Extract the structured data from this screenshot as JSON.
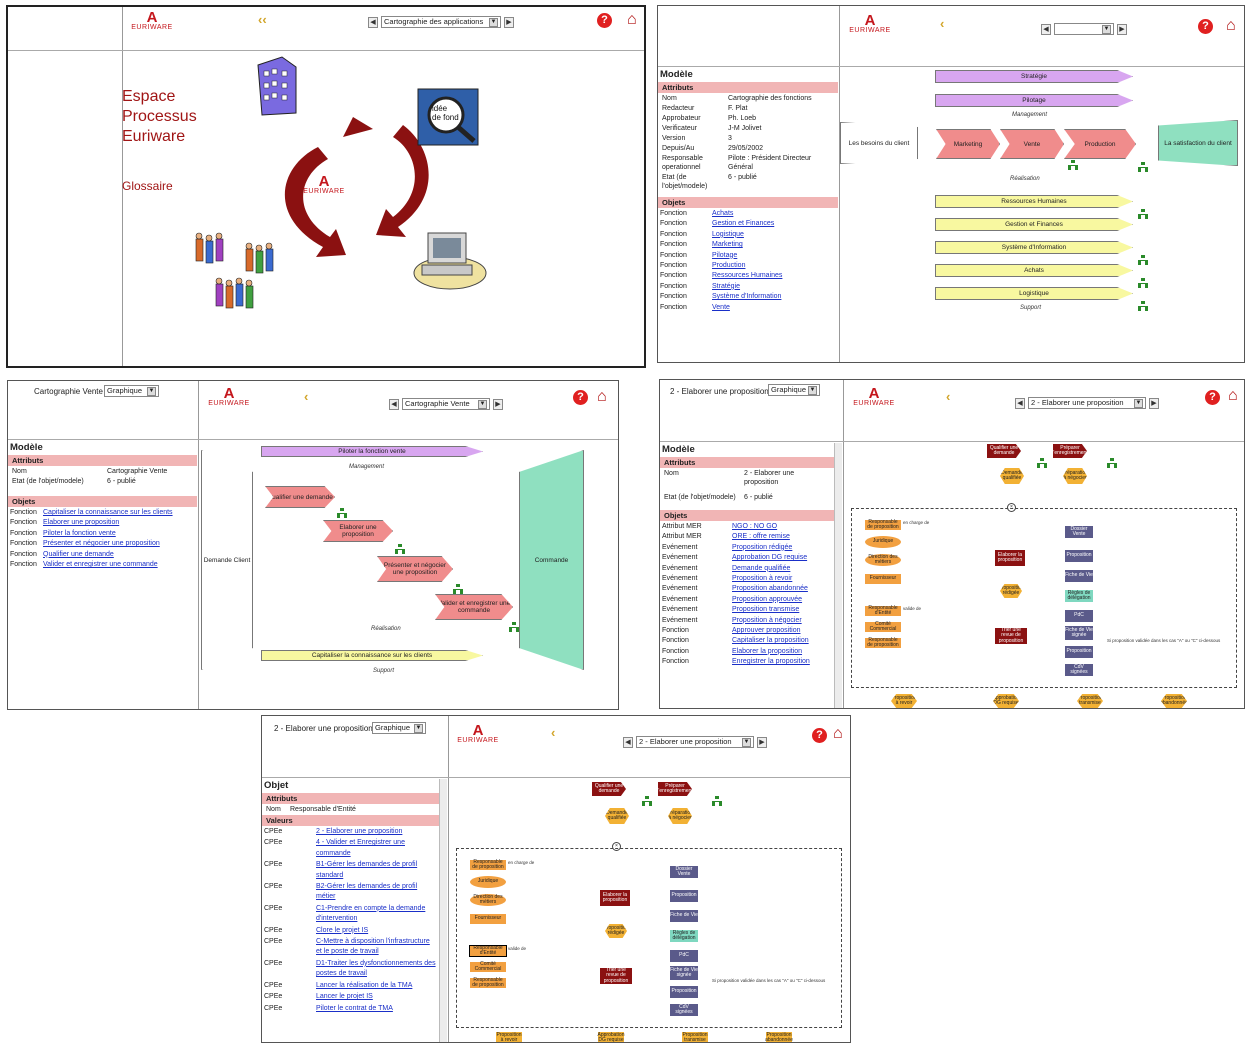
{
  "brand": {
    "letter": "A",
    "name": "EURIWARE"
  },
  "icons": {
    "help": "help-icon",
    "home": "home-icon",
    "back": "back-arrow-icon",
    "arrows": "cycle-arrows-icon",
    "building": "building-icon",
    "magnifier": "magnifier-icon",
    "computer": "computer-icon",
    "people": "people-icon",
    "org": "org-unit-icon"
  },
  "shot1": {
    "nav_select": "Cartographie des applications",
    "title_lines": [
      "Espace",
      "Processus",
      "Euriware"
    ],
    "glossaire": "Glossaire",
    "magnifier_text": "idée de fond de tableau"
  },
  "shot2": {
    "nav_select": "",
    "modele": "Modèle",
    "attributs": "Attributs",
    "attrs": [
      {
        "k": "Nom",
        "v": "Cartographie des fonctions"
      },
      {
        "k": "Redacteur",
        "v": "F. Plat"
      },
      {
        "k": "Approbateur",
        "v": "Ph. Loeb"
      },
      {
        "k": "Verificateur",
        "v": "J-M Jolivet"
      },
      {
        "k": "Version",
        "v": "3"
      },
      {
        "k": "Depuis/Au",
        "v": "29/05/2002"
      },
      {
        "k": "Responsable operationnel",
        "v": "Pilote : Président Directeur Général"
      },
      {
        "k": "Etat (de l'objet/modele)",
        "v": "6 - publié"
      }
    ],
    "objets": "Objets",
    "objs": [
      {
        "k": "Fonction",
        "v": "Achats"
      },
      {
        "k": "Fonction",
        "v": "Gestion et Finances"
      },
      {
        "k": "Fonction",
        "v": "Logistique"
      },
      {
        "k": "Fonction",
        "v": "Marketing"
      },
      {
        "k": "Fonction",
        "v": "Pilotage"
      },
      {
        "k": "Fonction",
        "v": "Production"
      },
      {
        "k": "Fonction",
        "v": "Ressources Humaines"
      },
      {
        "k": "Fonction",
        "v": "Stratégie"
      },
      {
        "k": "Fonction",
        "v": "Système d'Information"
      },
      {
        "k": "Fonction",
        "v": "Vente"
      }
    ],
    "diagram": {
      "strategie": "Stratégie",
      "pilotage": "Pilotage",
      "management": "Management",
      "besoins": "Les besoins du client",
      "satisfaction": "La satisfaction du client",
      "marketing": "Marketing",
      "vente": "Vente",
      "production": "Production",
      "realisation": "Réalisation",
      "rh": "Ressources Humaines",
      "gestion": "Gestion et Finances",
      "si": "Système d'Information",
      "achats": "Achats",
      "logistique": "Logistique",
      "support": "Support"
    }
  },
  "shot3": {
    "model_name": "Cartographie Vente",
    "view": "Graphique",
    "nav_select": "Cartographie Vente",
    "modele": "Modèle",
    "attributs": "Attributs",
    "attrs": [
      {
        "k": "Nom",
        "v": "Cartographie Vente"
      },
      {
        "k": "Etat (de l'objet/modele)",
        "v": "6 - publié"
      }
    ],
    "objets": "Objets",
    "objs": [
      {
        "k": "Fonction",
        "v": "Capitaliser la connaissance sur les clients"
      },
      {
        "k": "Fonction",
        "v": "Elaborer une proposition"
      },
      {
        "k": "Fonction",
        "v": "Piloter la fonction vente"
      },
      {
        "k": "Fonction",
        "v": "Présenter et négocier une proposition"
      },
      {
        "k": "Fonction",
        "v": "Qualifier une demande"
      },
      {
        "k": "Fonction",
        "v": "Valider et enregistrer une commande"
      }
    ],
    "diagram": {
      "piloter": "Piloter la fonction vente",
      "management": "Management",
      "demande": "Demande Client",
      "commande": "Commande",
      "qualifier": "Qualifier une demande",
      "elaborer": "Elaborer une proposition",
      "presenter": "Présenter et négocier une proposition",
      "valider": "Valider et enregistrer une commande",
      "realisation": "Réalisation",
      "capitaliser": "Capitaliser la connaissance sur les clients",
      "support": "Support"
    }
  },
  "shot4": {
    "model_name": "2 - Elaborer une proposition",
    "view": "Graphique",
    "nav_select": "2 - Elaborer une proposition",
    "modele": "Modèle",
    "attributs": "Attributs",
    "attrs": [
      {
        "k": "Nom",
        "v": "2 - Elaborer une proposition"
      },
      {
        "k": "Etat (de l'objet/modele)",
        "v": "6 - publié"
      }
    ],
    "objets": "Objets",
    "objs": [
      {
        "k": "Attribut MER",
        "v": "NGO : NO GO"
      },
      {
        "k": "Attribut MER",
        "v": "ORE : offre remise"
      },
      {
        "k": "Evénement",
        "v": "Proposition rédigée"
      },
      {
        "k": "Evénement",
        "v": "Approbation DG requise"
      },
      {
        "k": "Evénement",
        "v": "Demande qualifiée"
      },
      {
        "k": "Evénement",
        "v": "Proposition à revoir"
      },
      {
        "k": "Evénement",
        "v": "Proposition abandonnée"
      },
      {
        "k": "Evénement",
        "v": "Proposition approuvée"
      },
      {
        "k": "Evénement",
        "v": "Proposition transmise"
      },
      {
        "k": "Evénement",
        "v": "Proposition à négocier"
      },
      {
        "k": "Fonction",
        "v": "Approuver proposition"
      },
      {
        "k": "Fonction",
        "v": "Capitaliser la proposition"
      },
      {
        "k": "Fonction",
        "v": "Elaborer la proposition"
      },
      {
        "k": "Fonction",
        "v": "Enregistrer la proposition"
      }
    ]
  },
  "shot5": {
    "model_name": "2 - Elaborer une proposition",
    "view": "Graphique",
    "nav_select": "2 - Elaborer une proposition",
    "objet": "Objet",
    "attributs": "Attributs",
    "attrs": [
      {
        "k": "Nom",
        "v": "Responsable d'Entité"
      }
    ],
    "valeurs": "Valeurs",
    "objs": [
      {
        "k": "CPEe",
        "v": "2 - Elaborer une proposition"
      },
      {
        "k": "CPEe",
        "v": "4 - Valider et Enregistrer une commande"
      },
      {
        "k": "CPEe",
        "v": "B1-Gérer les demandes de profil standard"
      },
      {
        "k": "CPEe",
        "v": "B2-Gérer les demandes de profil métier"
      },
      {
        "k": "CPEe",
        "v": "C1-Prendre en compte la demande d'intervention"
      },
      {
        "k": "CPEe",
        "v": "Clore le projet IS"
      },
      {
        "k": "CPEe",
        "v": "C-Mettre à disposition l'infrastructure et le poste de travail"
      },
      {
        "k": "CPEe",
        "v": "D1-Traiter les dysfonctionnements des postes de travail"
      },
      {
        "k": "CPEe",
        "v": "Lancer la réalisation de la TMA"
      },
      {
        "k": "CPEe",
        "v": "Lancer le projet IS"
      },
      {
        "k": "CPEe",
        "v": "Piloter le contrat de TMA"
      }
    ]
  },
  "epc": {
    "qualifier": "Qualifier une demande",
    "preparer": "Préparer l'enregistrement",
    "demande": "Demande qualifiée",
    "preparation": "Préparation à négocier",
    "resp1": "Responsable de proposition",
    "charge": "en charge de",
    "juridique": "Juridique",
    "direction": "Direction des métiers",
    "fournisseur": "Fournisseur",
    "elaborer": "Elaborer la proposition",
    "dossier": "Dossier Vente",
    "proposition": "Proposition",
    "fiche": "Fiche de Vie",
    "redigee": "Proposition rédigée",
    "reglesoc": "Règles de délégation",
    "resp2": "Responsable d'Entité",
    "resp3": "Comité Commercial",
    "resp4": "Responsable de proposition",
    "valide": "valide de",
    "trier": "Trier une revue de proposition",
    "pdc": "PdC",
    "fichevie": "Fiche de Vie signée",
    "proposition2": "Proposition",
    "cgv": "CdV signées",
    "note": "Si proposition validée dans les cas \"A\" ou \"C\" ci-dessous",
    "bottom": [
      "Proposition à revoir",
      "Approbation DG requise",
      "Proposition transmise",
      "Proposition abandonnée"
    ]
  }
}
